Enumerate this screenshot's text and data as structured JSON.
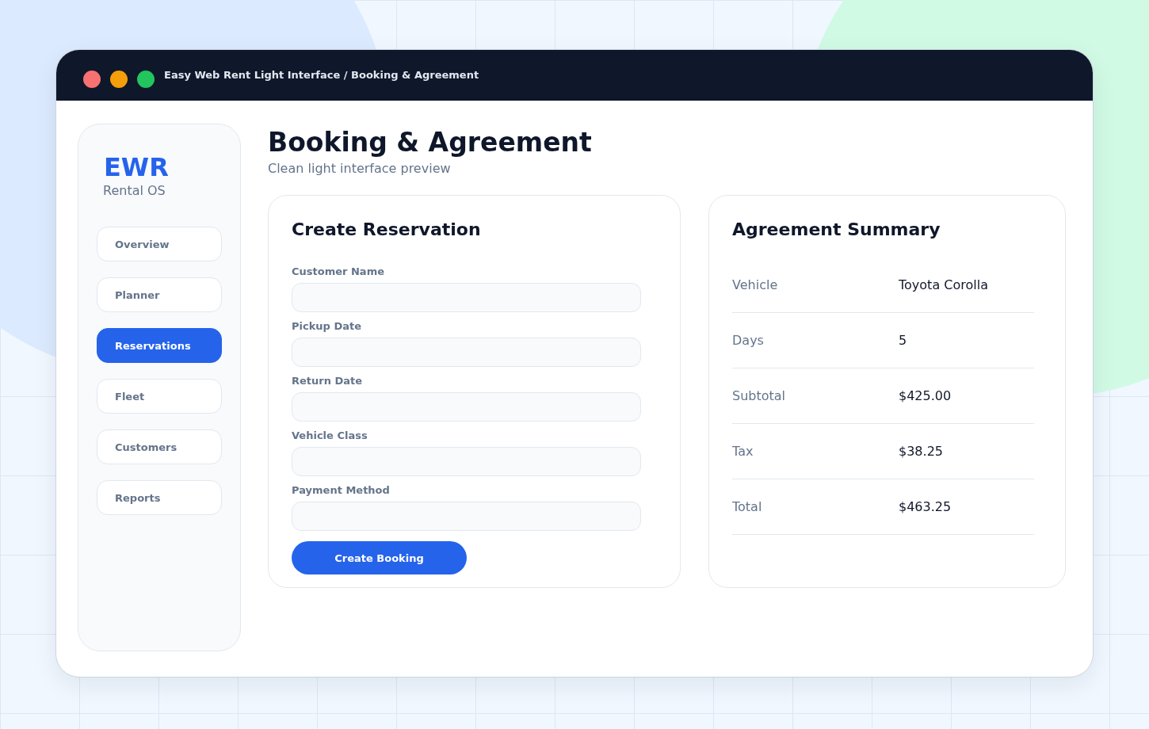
{
  "window": {
    "title": "Easy Web Rent Light Interface / Booking & Agreement"
  },
  "sidebar": {
    "logo": "EWR",
    "subtitle": "Rental OS",
    "items": [
      {
        "label": "Overview",
        "selected": false
      },
      {
        "label": "Planner",
        "selected": false
      },
      {
        "label": "Reservations",
        "selected": true
      },
      {
        "label": "Fleet",
        "selected": false
      },
      {
        "label": "Customers",
        "selected": false
      },
      {
        "label": "Reports",
        "selected": false
      }
    ]
  },
  "page": {
    "title": "Booking & Agreement",
    "subtitle": "Clean light interface preview"
  },
  "reservation_form": {
    "title": "Create Reservation",
    "fields": [
      {
        "label": "Customer Name"
      },
      {
        "label": "Pickup Date"
      },
      {
        "label": "Return Date"
      },
      {
        "label": "Vehicle Class"
      },
      {
        "label": "Payment Method"
      }
    ],
    "submit": "Create Booking"
  },
  "agreement_summary": {
    "title": "Agreement Summary",
    "rows": [
      {
        "label": "Vehicle",
        "value": "Toyota Corolla"
      },
      {
        "label": "Days",
        "value": "5"
      },
      {
        "label": "Subtotal",
        "value": "$425.00"
      },
      {
        "label": "Tax",
        "value": "$38.25"
      },
      {
        "label": "Total",
        "value": "$463.25"
      }
    ]
  }
}
